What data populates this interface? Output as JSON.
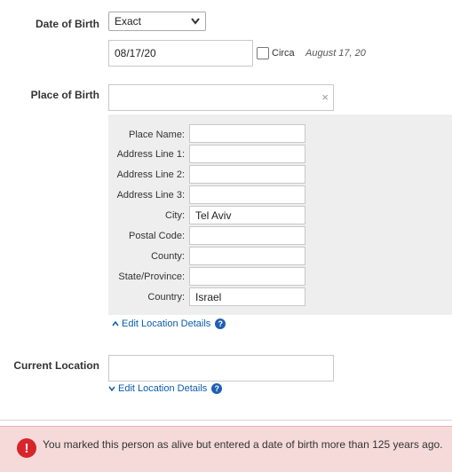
{
  "date_of_birth": {
    "label": "Date of Birth",
    "type_select": "Exact",
    "value": "08/17/20",
    "circa_label": "Circa",
    "circa_checked": false,
    "formatted_date": "August 17, 20"
  },
  "place_of_birth": {
    "label": "Place of Birth",
    "value": "",
    "clear_glyph": "×",
    "fields": [
      {
        "label": "Place Name:",
        "value": ""
      },
      {
        "label": "Address Line 1:",
        "value": ""
      },
      {
        "label": "Address Line 2:",
        "value": ""
      },
      {
        "label": "Address Line 3:",
        "value": ""
      },
      {
        "label": "City:",
        "value": "Tel Aviv"
      },
      {
        "label": "Postal Code:",
        "value": ""
      },
      {
        "label": "County:",
        "value": ""
      },
      {
        "label": "State/Province:",
        "value": ""
      },
      {
        "label": "Country:",
        "value": "Israel"
      }
    ],
    "edit_link": "Edit Location Details",
    "help_glyph": "?"
  },
  "current_location": {
    "label": "Current Location",
    "value": "",
    "edit_link": "Edit Location Details",
    "help_glyph": "?"
  },
  "alert": {
    "icon_glyph": "!",
    "message": "You marked this person as alive but entered a date of birth more than 125 years ago."
  },
  "colors": {
    "link": "#0b5cab",
    "alert_bg": "#f6dada",
    "alert_icon": "#d7262b",
    "panel_bg": "#eeeeee"
  }
}
